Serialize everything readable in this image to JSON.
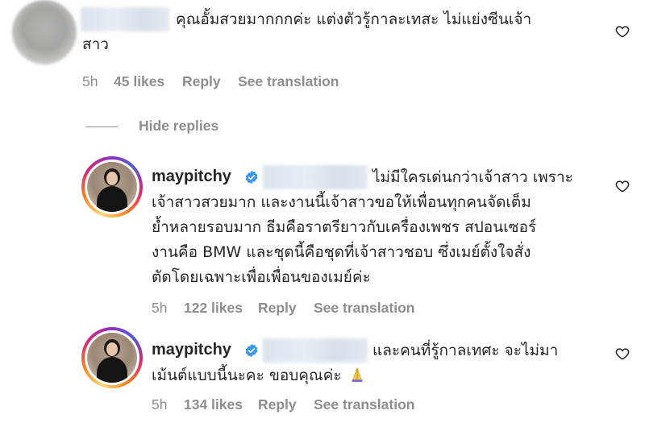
{
  "comment1": {
    "text": "คุณอั้มสวยมากกกค่ะ แต่งตัวรู้กาละเทสะ ไม่แย่งซีนเจ้า",
    "text_line2": "สาว",
    "time": "5h",
    "likes": "45 likes",
    "reply": "Reply",
    "translate": "See translation"
  },
  "thread": {
    "hide_replies": "Hide replies"
  },
  "reply1": {
    "username": "maypitchy",
    "lines": [
      "ไม่มีใครเด่นกว่าเจ้าสาว เพราะ",
      "เจ้าสาวสวยมาก และงานนี้เจ้าสาวขอให้เพื่อนทุกคนจัดเต็ม",
      "ย้ำหลายรอบมาก ธีมคือราตรียาวกับเครื่องเพชร สปอนเซอร์",
      "งานคือ BMW และชุดนี้คือชุดที่เจ้าสาวชอบ ซึ่งเมย์ตั้งใจสั่ง",
      "ตัดโดยเฉพาะเพื่อเพื่อนของเมย์ค่ะ"
    ],
    "time": "5h",
    "likes": "122 likes",
    "reply": "Reply",
    "translate": "See translation"
  },
  "reply2": {
    "username": "maypitchy",
    "lines": [
      "และคนที่รู้กาลเทศะ จะไม่มา",
      "เม้นต์แบบนี้นะคะ ขอบคุณค่ะ"
    ],
    "time": "5h",
    "likes": "134 likes",
    "reply": "Reply",
    "translate": "See translation"
  },
  "icons": {
    "heart": "heart-outline-icon",
    "verified": "verified-badge-icon",
    "hands": "folded-hands-emoji"
  },
  "colors": {
    "text": "#262626",
    "muted": "#8e8e8e",
    "verified": "#3897f0"
  }
}
